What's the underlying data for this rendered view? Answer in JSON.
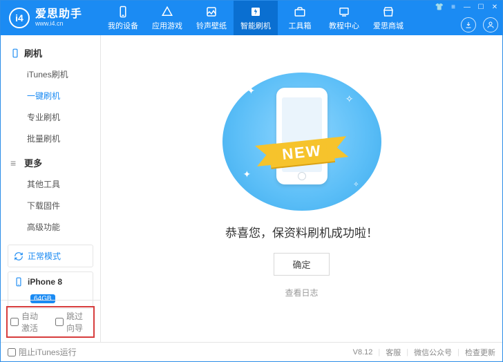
{
  "brand": {
    "name": "爱思助手",
    "site": "www.i4.cn",
    "mark": "i4"
  },
  "tabs": [
    {
      "label": "我的设备"
    },
    {
      "label": "应用游戏"
    },
    {
      "label": "铃声壁纸"
    },
    {
      "label": "智能刷机"
    },
    {
      "label": "工具箱"
    },
    {
      "label": "教程中心"
    },
    {
      "label": "爱思商城"
    }
  ],
  "sidebar": {
    "group1": {
      "title": "刷机",
      "items": [
        "iTunes刷机",
        "一键刷机",
        "专业刷机",
        "批量刷机"
      ],
      "activeIndex": 1
    },
    "group2": {
      "title": "更多",
      "items": [
        "其他工具",
        "下载固件",
        "高级功能"
      ]
    },
    "mode": {
      "label": "正常模式"
    },
    "device": {
      "name": "iPhone 8",
      "storage": "64GB"
    }
  },
  "checks": {
    "auto_activate": "自动激活",
    "skip_guide": "跳过向导"
  },
  "main": {
    "ribbon": "NEW",
    "message": "恭喜您，保资料刷机成功啦！",
    "ok": "确定",
    "view_log": "查看日志"
  },
  "footer": {
    "block_itunes": "阻止iTunes运行",
    "version": "V8.12",
    "support": "客服",
    "wechat": "微信公众号",
    "update": "检查更新"
  }
}
